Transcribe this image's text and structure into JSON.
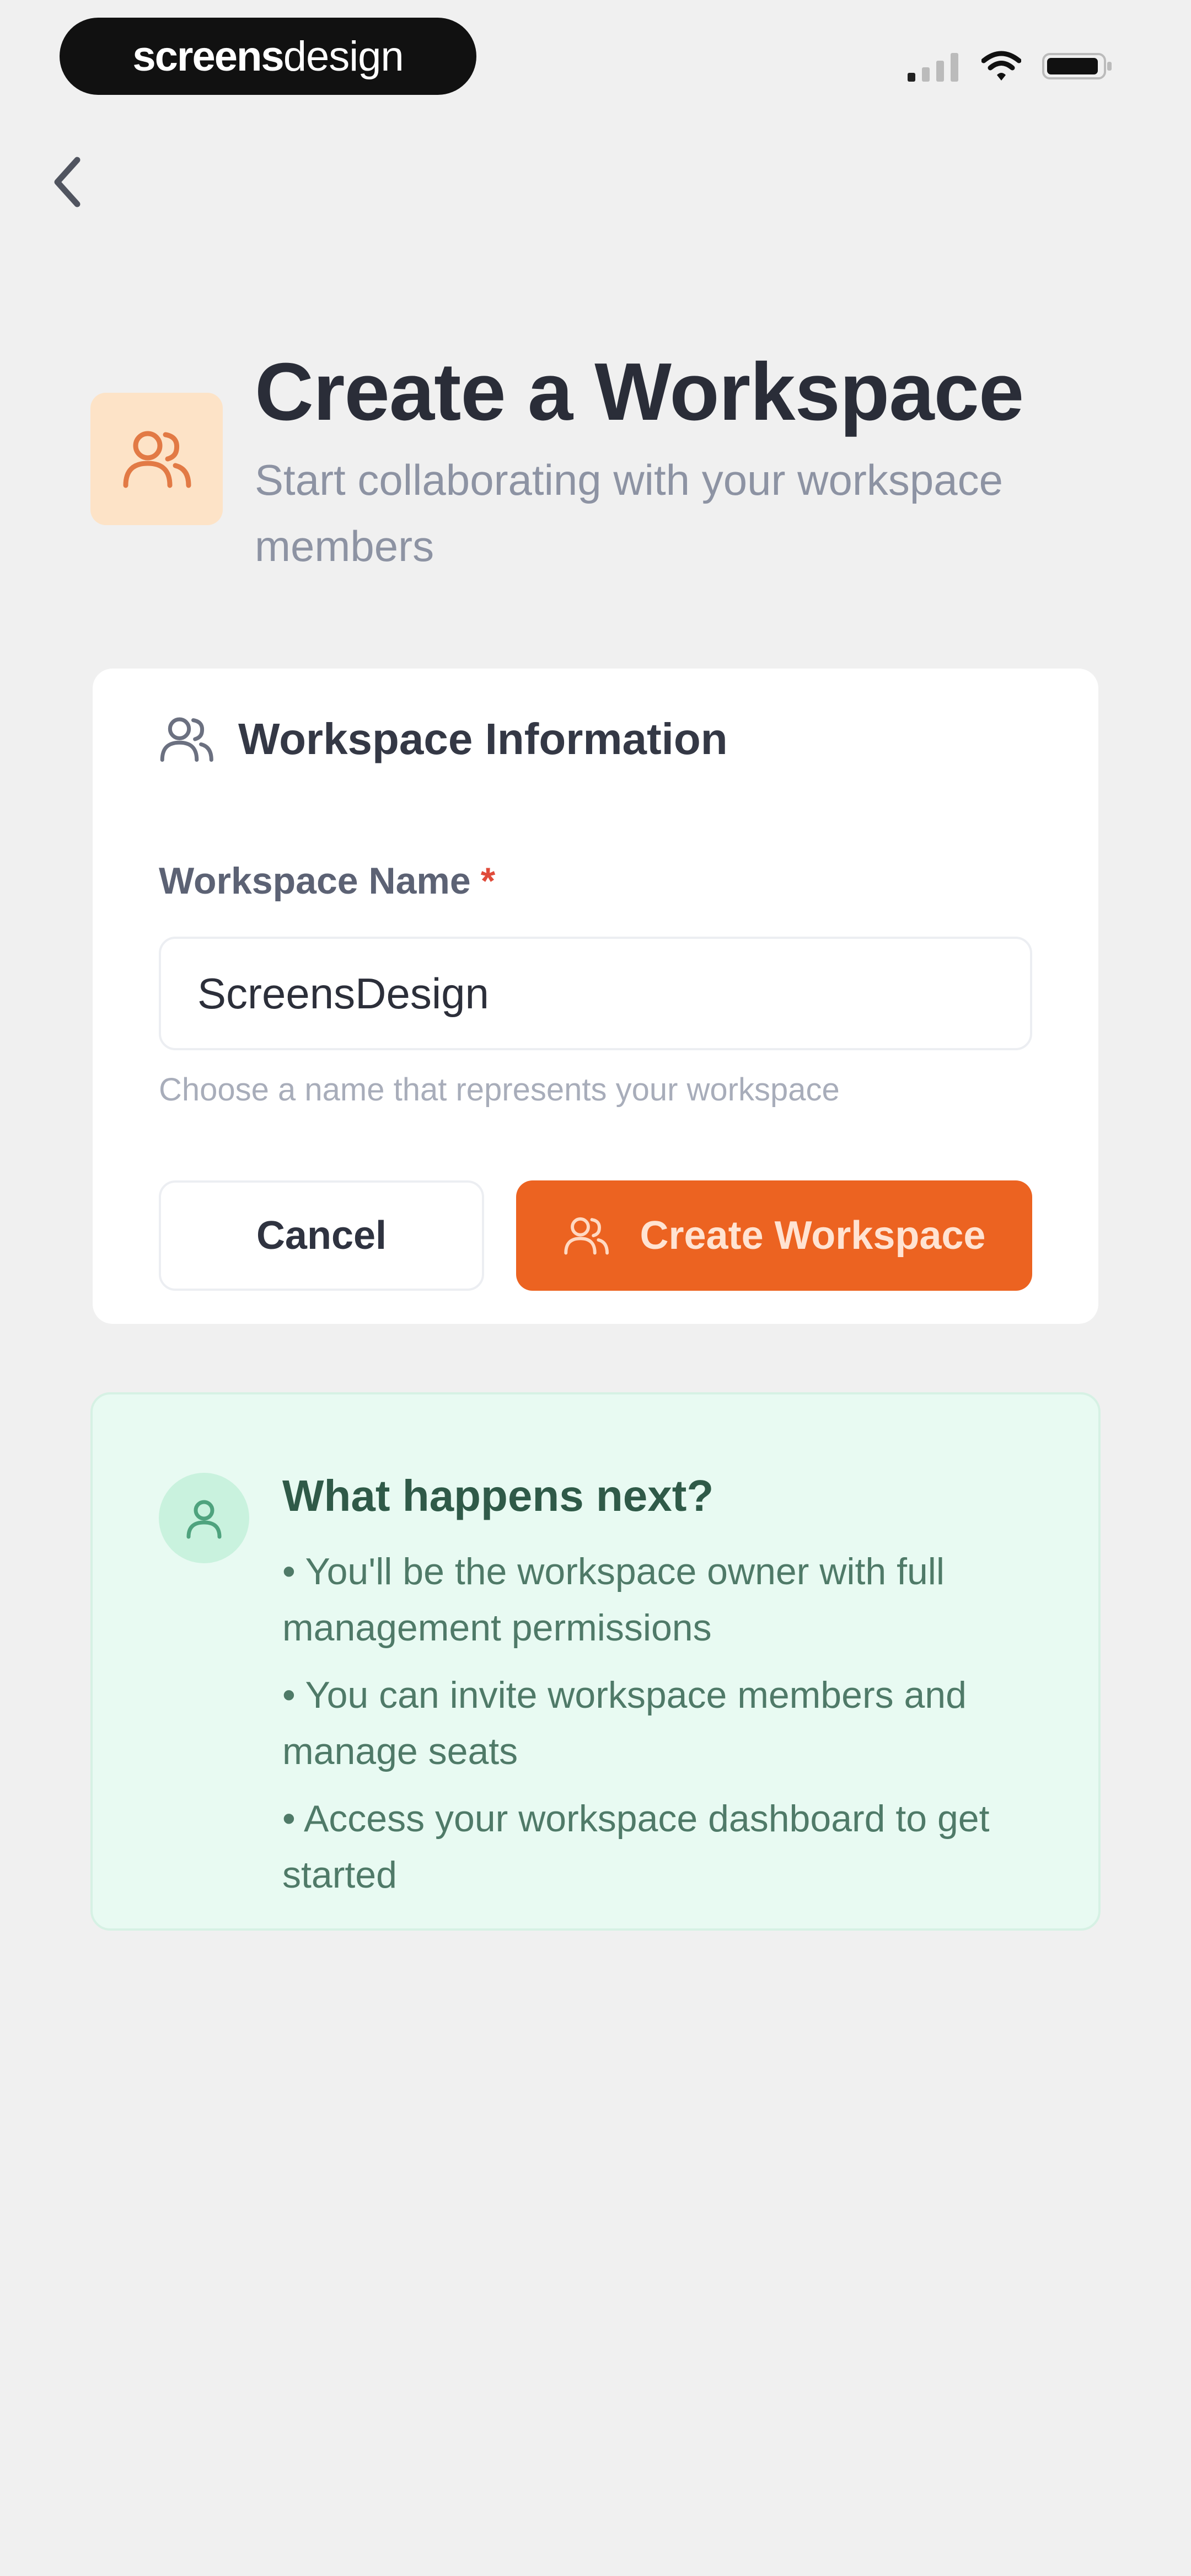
{
  "status_bar": {
    "brand_bold": "screens",
    "brand_light": "design",
    "icons": [
      "signal-icon",
      "wifi-icon",
      "battery-icon"
    ]
  },
  "header": {
    "back_icon": "chevron-left-icon",
    "title": "Create a Workspace",
    "subtitle": "Start collaborating with your workspace members",
    "hero_icon": "users-icon"
  },
  "form_card": {
    "header_icon": "users-icon",
    "header_title": "Workspace Information",
    "field_label": "Workspace Name",
    "required_mark": "*",
    "field_value": "ScreensDesign",
    "field_help": "Choose a name that represents your workspace",
    "cancel_label": "Cancel",
    "create_label": "Create Workspace",
    "create_icon": "users-icon"
  },
  "info_card": {
    "icon": "user-icon",
    "title": "What happens next?",
    "items": [
      "• You'll be the workspace owner with full management permissions",
      "• You can invite workspace members and manage seats",
      "• Access your workspace dashboard to get started"
    ]
  },
  "colors": {
    "background": "#f0f0f0",
    "accent": "#ec6321",
    "hero_icon_bg": "#fde3c7",
    "info_bg": "#e8faf2",
    "info_text": "#4f7a68"
  }
}
